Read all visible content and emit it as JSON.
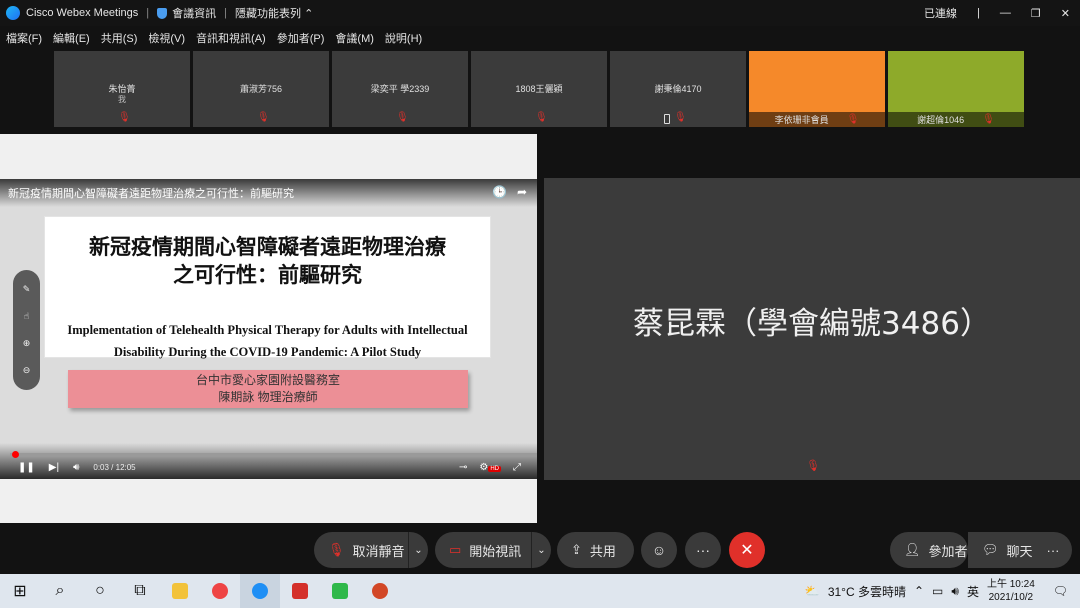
{
  "titlebar": {
    "app_name": "Cisco Webex Meetings",
    "meeting_info": "會議資訊",
    "hidden_toolbar": "隱藏功能表列",
    "connection_status": "已連線"
  },
  "menu": [
    "檔案(F)",
    "編輯(E)",
    "共用(S)",
    "檢視(V)",
    "音訊和視訊(A)",
    "參加者(P)",
    "會議(M)",
    "說明(H)"
  ],
  "participants": [
    {
      "name": "朱怡菁",
      "sub": "我"
    },
    {
      "name": "蕭淑芳756",
      "sub": ""
    },
    {
      "name": "梁奕平 學2339",
      "sub": ""
    },
    {
      "name": "1808王儷穎",
      "sub": ""
    },
    {
      "name": "謝秉倫4170",
      "sub": ""
    },
    {
      "name": "李依珊非會員",
      "sub": ""
    },
    {
      "name": "謝超倫1046",
      "sub": ""
    }
  ],
  "video": {
    "title": "新冠疫情期間心智障礙者遠距物理治療之可行性：前驅研究",
    "slide_cn_line1": "新冠疫情期間心智障礙者遠距物理治療",
    "slide_cn_line2": "之可行性：前驅研究",
    "slide_en_line1": "Implementation of Telehealth Physical Therapy for Adults with Intellectual",
    "slide_en_line2": "Disability During the COVID-19 Pandemic: A Pilot Study",
    "org": "台中市愛心家園附設醫務室",
    "author": "陳期詠 物理治療師",
    "time": "0:03 / 12:05",
    "progress": 0.004
  },
  "speaker": {
    "name": "蔡昆霖（學會編號3486）"
  },
  "controls": {
    "unmute": "取消靜音",
    "start_video": "開始視訊",
    "share": "共用",
    "participants": "參加者",
    "chat": "聊天"
  },
  "taskbar": {
    "weather": "31°C 多雲時晴",
    "ime": "英",
    "time": "上午 10:24",
    "date": "2021/10/2"
  },
  "colors": {
    "orange_tile": "#f5892a",
    "olive_tile": "#8eaa2a",
    "end_call": "#e0302a"
  }
}
